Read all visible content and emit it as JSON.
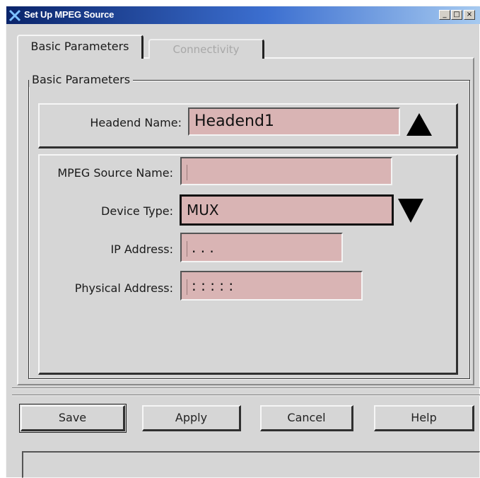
{
  "window": {
    "title": "Set Up MPEG Source",
    "controls": {
      "minimize": "_",
      "maximize": "□",
      "close": "×"
    }
  },
  "tabs": [
    {
      "label": "Basic Parameters",
      "selected": true
    },
    {
      "label": "Connectivity",
      "selected": false
    }
  ],
  "group": {
    "legend": "Basic Parameters"
  },
  "headend": {
    "label": "Headend Name:",
    "value": "Headend1",
    "spin_icon": "triangle-up-icon"
  },
  "form": {
    "mpeg_source_name": {
      "label": "MPEG Source Name:",
      "value": ""
    },
    "device_type": {
      "label": "Device Type:",
      "value": "MUX",
      "dropdown_icon": "triangle-down-icon"
    },
    "ip_address": {
      "label": "IP Address:",
      "value": ". . ."
    },
    "physical_address": {
      "label": "Physical Address:",
      "value": ": : : : :"
    }
  },
  "buttons": {
    "save": "Save",
    "apply": "Apply",
    "cancel": "Cancel",
    "help": "Help"
  },
  "status": {
    "text": ""
  },
  "colors": {
    "field_bg": "#d9b4b4",
    "window_bg": "#d6d6d6",
    "title_bar": "#0a246a"
  }
}
